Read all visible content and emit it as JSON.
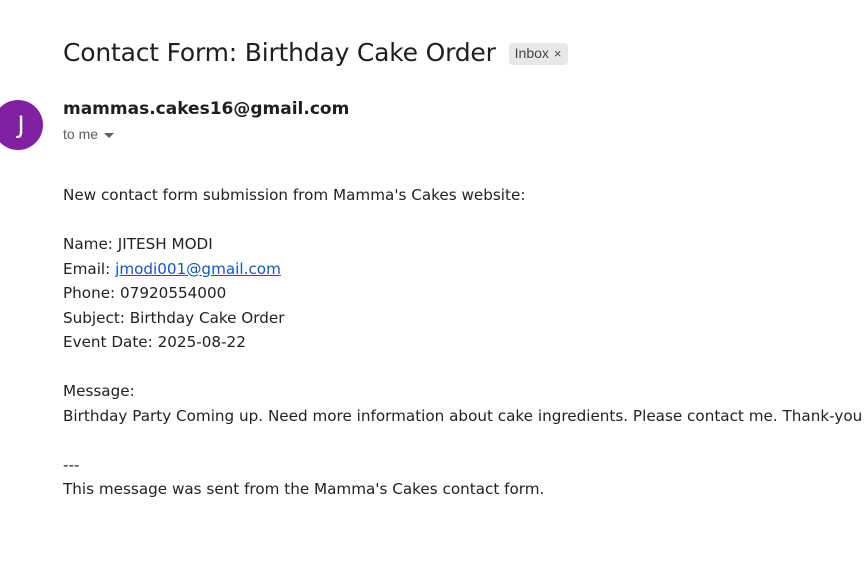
{
  "subject": "Contact Form: Birthday Cake Order",
  "label": {
    "text": "Inbox",
    "close": "×"
  },
  "sender": {
    "avatar_letter": "J",
    "avatar_color": "#8120a0",
    "email": "mammas.cakes16@gmail.com",
    "recipient": "to me"
  },
  "body": {
    "intro": "New contact form submission from Mamma's Cakes website:",
    "name_label": "Name: ",
    "name_value": "JITESH MODI",
    "email_label": "Email: ",
    "email_value": "jmodi001@gmail.com",
    "phone_label": "Phone: ",
    "phone_value": "07920554000",
    "subject_label": "Subject: ",
    "subject_value": "Birthday Cake Order",
    "event_date_label": "Event Date: ",
    "event_date_value": "2025-08-22",
    "message_label": "Message:",
    "message_value": "Birthday Party Coming up. Need more information about cake ingredients. Please contact me. Thank-you.",
    "separator": "---",
    "footer": "This message was sent from the Mamma's Cakes contact form."
  },
  "colors": {
    "link": "#1155cc",
    "chip_background": "#e8e8e8"
  }
}
